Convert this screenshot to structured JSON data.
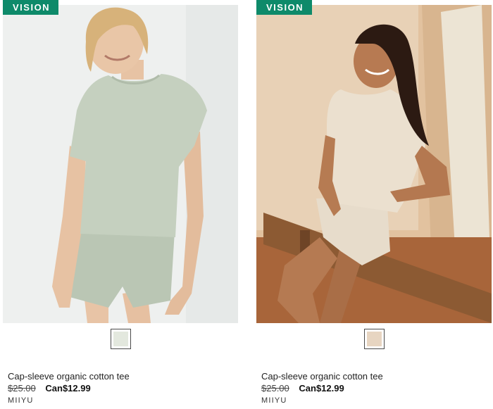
{
  "products": [
    {
      "badge": "vision",
      "title": "Cap-sleeve organic cotton tee",
      "original_price": "$25.00",
      "sale_price": "Can$12.99",
      "brand": "MIIYU",
      "swatch_color": "#e3e8de"
    },
    {
      "badge": "vision",
      "title": "Cap-sleeve organic cotton tee",
      "original_price": "$25.00",
      "sale_price": "Can$12.99",
      "brand": "MIIYU",
      "swatch_color": "#e7d5c1"
    }
  ],
  "colors": {
    "badge_bg": "#0e8a6a",
    "sage": "#c5d0bf",
    "sand": "#e9dccb"
  }
}
